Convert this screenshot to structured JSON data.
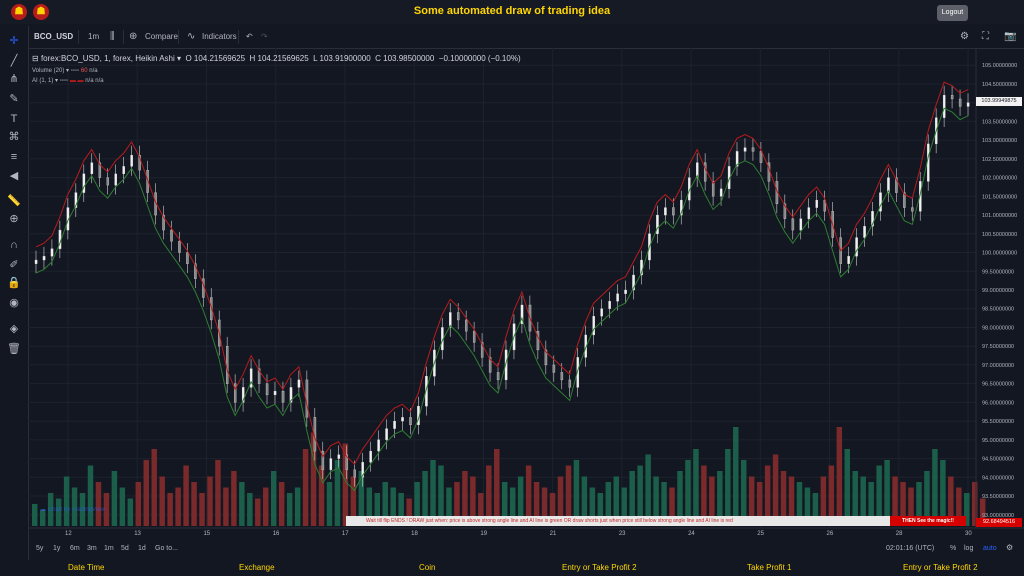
{
  "app": {
    "title": "Some automated draw of trading idea",
    "logout": "Logout"
  },
  "toolbar": {
    "symbol": "BCO_USD",
    "interval": "1m",
    "compare": "Compare",
    "indicators": "Indicators"
  },
  "legend": {
    "main": "forex:BCO_USD, 1, forex, Heikin Ashi",
    "open": "O 104.21569625",
    "high": "H 104.21569625",
    "low": "L 103.91900000",
    "close": "C 103.98500000",
    "change": "−0.10000000 (−0.10%)",
    "volume_label": "Volume (20)",
    "volume_value": "60",
    "volume_na": "n/a",
    "ai_label": "AI (1, 1)",
    "ai_na1": "n/a",
    "ai_na2": "n/a"
  },
  "chart_data": {
    "type": "candlestick",
    "y_ticks": [
      "105.00000000",
      "104.50000000",
      "104.00000000",
      "103.50000000",
      "103.00000000",
      "102.50000000",
      "102.00000000",
      "101.50000000",
      "101.00000000",
      "100.50000000",
      "100.00000000",
      "99.50000000",
      "99.00000000",
      "98.50000000",
      "98.00000000",
      "97.50000000",
      "97.00000000",
      "96.50000000",
      "96.00000000",
      "95.50000000",
      "95.00000000",
      "94.50000000",
      "94.00000000",
      "93.50000000",
      "93.00000000"
    ],
    "ylim": [
      92.7,
      105.3
    ],
    "x_ticks": [
      "12",
      "13",
      "15",
      "16",
      "17",
      "18",
      "19",
      "21",
      "23",
      "24",
      "25",
      "26",
      "28",
      "30"
    ],
    "current_price": "103.99949875",
    "bottom_price": "92.68494516",
    "close_trace": [
      99.8,
      99.9,
      100.1,
      100.6,
      101.2,
      101.6,
      102.1,
      102.4,
      102.0,
      101.8,
      102.1,
      102.3,
      102.6,
      102.2,
      101.6,
      101.0,
      100.6,
      100.3,
      100.0,
      99.7,
      99.3,
      98.8,
      98.2,
      97.5,
      96.5,
      96.0,
      96.4,
      96.9,
      96.5,
      96.2,
      96.3,
      96.0,
      96.4,
      96.6,
      95.6,
      94.7,
      94.2,
      94.5,
      94.6,
      94.2,
      94.0,
      94.4,
      94.7,
      95.0,
      95.3,
      95.5,
      95.6,
      95.4,
      95.9,
      96.7,
      97.4,
      98.0,
      98.4,
      98.2,
      97.9,
      97.6,
      97.2,
      96.8,
      96.6,
      97.4,
      98.1,
      98.6,
      97.9,
      97.4,
      97.0,
      96.8,
      96.6,
      96.4,
      97.2,
      97.8,
      98.3,
      98.5,
      98.7,
      98.9,
      99.0,
      99.4,
      99.8,
      100.5,
      101.0,
      101.2,
      101.0,
      101.4,
      102.0,
      102.4,
      101.9,
      101.5,
      101.7,
      102.3,
      102.7,
      102.8,
      102.7,
      102.4,
      101.9,
      101.3,
      100.9,
      100.6,
      100.9,
      101.2,
      101.4,
      101.1,
      100.4,
      99.7,
      99.9,
      100.4,
      100.7,
      101.1,
      101.6,
      102.0,
      101.6,
      101.2,
      101.1,
      101.9,
      102.9,
      103.6,
      104.2,
      104.1,
      103.9,
      104.0
    ],
    "volumes": [
      0.2,
      0.15,
      0.3,
      0.25,
      0.45,
      0.35,
      0.3,
      0.55,
      0.4,
      0.3,
      0.5,
      0.35,
      0.25,
      0.4,
      0.6,
      0.7,
      0.45,
      0.3,
      0.35,
      0.55,
      0.4,
      0.3,
      0.45,
      0.6,
      0.35,
      0.5,
      0.4,
      0.3,
      0.25,
      0.35,
      0.5,
      0.4,
      0.3,
      0.35,
      0.7,
      0.85,
      0.55,
      0.4,
      0.6,
      0.75,
      0.45,
      0.5,
      0.35,
      0.3,
      0.4,
      0.35,
      0.3,
      0.25,
      0.4,
      0.5,
      0.6,
      0.55,
      0.35,
      0.4,
      0.5,
      0.45,
      0.3,
      0.55,
      0.7,
      0.4,
      0.35,
      0.45,
      0.55,
      0.4,
      0.35,
      0.3,
      0.45,
      0.55,
      0.6,
      0.45,
      0.35,
      0.3,
      0.4,
      0.45,
      0.35,
      0.5,
      0.55,
      0.65,
      0.45,
      0.4,
      0.35,
      0.5,
      0.6,
      0.7,
      0.55,
      0.45,
      0.5,
      0.7,
      0.9,
      0.6,
      0.45,
      0.4,
      0.55,
      0.65,
      0.5,
      0.45,
      0.4,
      0.35,
      0.3,
      0.45,
      0.55,
      0.9,
      0.7,
      0.5,
      0.45,
      0.4,
      0.55,
      0.6,
      0.45,
      0.4,
      0.35,
      0.4,
      0.5,
      0.7,
      0.6,
      0.45,
      0.35,
      0.3,
      0.4,
      0.25
    ]
  },
  "time_info": "02:01:16 (UTC)",
  "scale_opts": [
    "%",
    "log",
    "auto"
  ],
  "timeframes": [
    "5y",
    "1y",
    "6m",
    "3m",
    "1m",
    "5d",
    "1d",
    "Go to..."
  ],
  "watermark": "Chart by TradingView",
  "banner": {
    "text": "Wait till flip ENDS !   DRAW just when:  price is above strong angle line and AI line is green        OR        draw shorts just when price still below strong angle line and AI line is red",
    "button": "THEN See the magic!!"
  },
  "footer": [
    "Date Time",
    "Exchange",
    "Coin",
    "Entry or Take Profit 2",
    "Take Profit 1",
    "Entry or Take Profit 2"
  ],
  "colors": {
    "up": "#26a69a",
    "down": "#ef5350",
    "green_line": "#2e7d32",
    "red_line": "#b71c1c",
    "accent": "#ffd600"
  }
}
